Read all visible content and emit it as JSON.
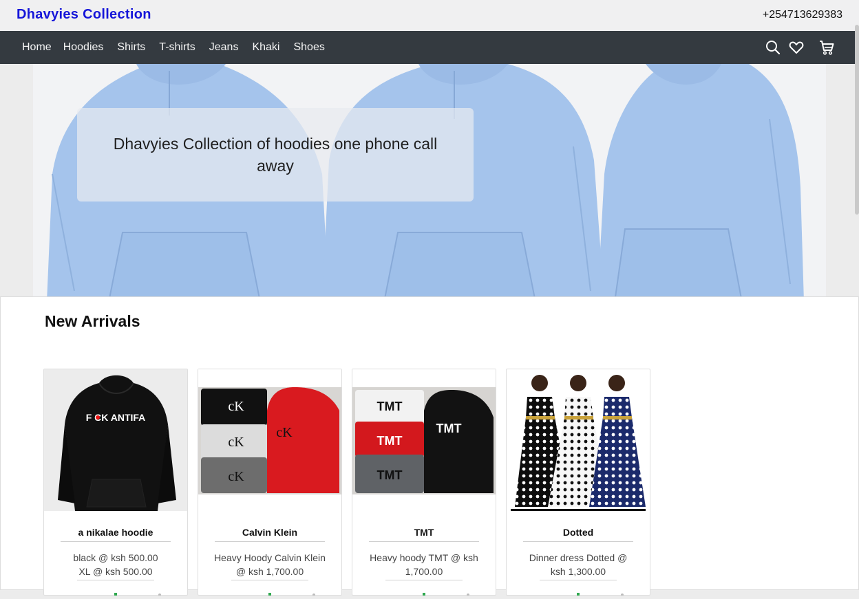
{
  "header": {
    "brand": "Dhavyies Collection",
    "phone": "+254713629383"
  },
  "nav": {
    "links": [
      "Home",
      "Hoodies",
      "Shirts",
      "T-shirts",
      "Jeans",
      "Khaki",
      "Shoes"
    ],
    "icons": [
      "search-icon",
      "heart-icon",
      "cart-icon"
    ]
  },
  "hero": {
    "caption": "Dhavyies Collection of hoodies one phone call away"
  },
  "section": {
    "title": "New Arrivals"
  },
  "products": [
    {
      "name": "a nikalae hoodie",
      "desc_line1": "black @ ksh 500.00",
      "desc_line2": "XL @ ksh 500.00",
      "print": "F CK ANTIFA"
    },
    {
      "name": "Calvin Klein",
      "desc_line1": "Heavy Hoody Calvin Klein",
      "desc_line2": "@ ksh 1,700.00",
      "print": "cK"
    },
    {
      "name": "TMT",
      "desc_line1": "Heavy hoody TMT @ ksh",
      "desc_line2": "1,700.00",
      "print": "TMT"
    },
    {
      "name": "Dotted",
      "desc_line1": "Dinner dress Dotted @",
      "desc_line2": "ksh 1,300.00"
    }
  ],
  "colors": {
    "brand": "#1515d9",
    "navbar": "#343a40",
    "hoodie_blue": "#a6c6ee"
  }
}
